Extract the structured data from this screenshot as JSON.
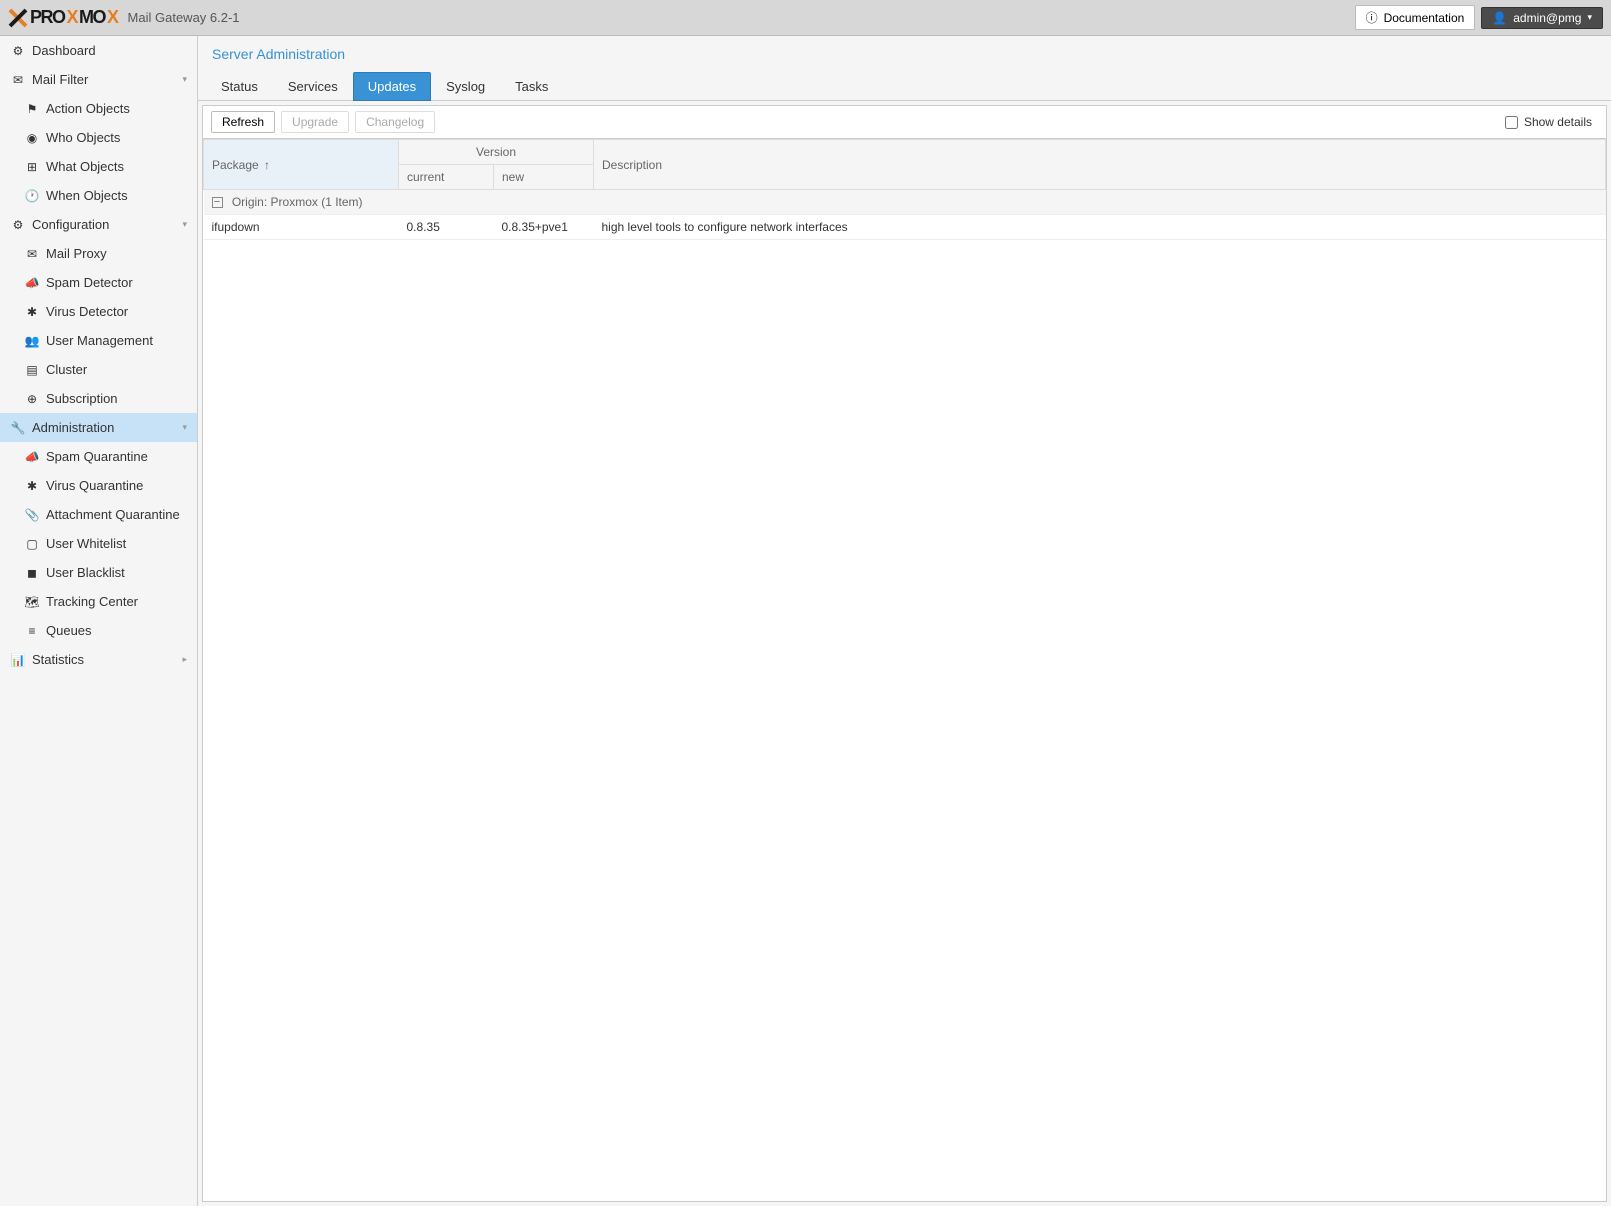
{
  "header": {
    "product": "Mail Gateway 6.2-1",
    "documentation": "Documentation",
    "user": "admin@pmg"
  },
  "sidebar": {
    "items": [
      {
        "label": "Dashboard",
        "icon": "⚙",
        "sub": false
      },
      {
        "label": "Mail Filter",
        "icon": "✉",
        "sub": false,
        "expand": true
      },
      {
        "label": "Action Objects",
        "icon": "⚑",
        "sub": true
      },
      {
        "label": "Who Objects",
        "icon": "◉",
        "sub": true
      },
      {
        "label": "What Objects",
        "icon": "⊞",
        "sub": true
      },
      {
        "label": "When Objects",
        "icon": "🕐",
        "sub": true
      },
      {
        "label": "Configuration",
        "icon": "⚙",
        "sub": false,
        "expand": true
      },
      {
        "label": "Mail Proxy",
        "icon": "✉",
        "sub": true
      },
      {
        "label": "Spam Detector",
        "icon": "📣",
        "sub": true
      },
      {
        "label": "Virus Detector",
        "icon": "✱",
        "sub": true
      },
      {
        "label": "User Management",
        "icon": "👥",
        "sub": true
      },
      {
        "label": "Cluster",
        "icon": "▤",
        "sub": true
      },
      {
        "label": "Subscription",
        "icon": "⊕",
        "sub": true
      },
      {
        "label": "Administration",
        "icon": "🔧",
        "sub": false,
        "active": true,
        "expand": true
      },
      {
        "label": "Spam Quarantine",
        "icon": "📣",
        "sub": true
      },
      {
        "label": "Virus Quarantine",
        "icon": "✱",
        "sub": true
      },
      {
        "label": "Attachment Quarantine",
        "icon": "📎",
        "sub": true
      },
      {
        "label": "User Whitelist",
        "icon": "▢",
        "sub": true
      },
      {
        "label": "User Blacklist",
        "icon": "◼",
        "sub": true
      },
      {
        "label": "Tracking Center",
        "icon": "🗺",
        "sub": true
      },
      {
        "label": "Queues",
        "icon": "≡",
        "sub": true
      },
      {
        "label": "Statistics",
        "icon": "📊",
        "sub": false,
        "collapsed": true
      }
    ]
  },
  "breadcrumb": {
    "title": "Server Administration"
  },
  "tabs": [
    {
      "label": "Status"
    },
    {
      "label": "Services"
    },
    {
      "label": "Updates",
      "active": true
    },
    {
      "label": "Syslog"
    },
    {
      "label": "Tasks"
    }
  ],
  "toolbar": {
    "refresh": "Refresh",
    "upgrade": "Upgrade",
    "changelog": "Changelog",
    "showDetails": "Show details"
  },
  "grid": {
    "headers": {
      "package": "Package",
      "version": "Version",
      "current": "current",
      "new": "new",
      "description": "Description"
    },
    "group": "Origin: Proxmox (1 Item)",
    "rows": [
      {
        "package": "ifupdown",
        "current": "0.8.35",
        "new": "0.8.35+pve1",
        "description": "high level tools to configure network interfaces"
      }
    ]
  }
}
